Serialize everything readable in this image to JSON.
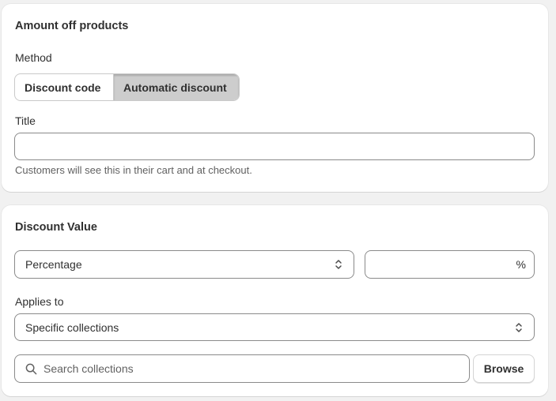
{
  "amount_card": {
    "title": "Amount off products",
    "method_label": "Method",
    "method_options": [
      "Discount code",
      "Automatic discount"
    ],
    "selected_method": "Automatic discount",
    "title_field_label": "Title",
    "title_value": "",
    "title_help": "Customers will see this in their cart and at checkout."
  },
  "value_card": {
    "title": "Discount Value",
    "value_type": "Percentage",
    "value_amount": "",
    "percent_suffix": "%",
    "applies_label": "Applies to",
    "applies_value": "Specific collections",
    "search_placeholder": "Search collections",
    "browse_label": "Browse"
  },
  "icons": {
    "select_chevron": "chevron-up-down-icon",
    "search": "search-icon"
  },
  "colors": {
    "selected_segment": "#cdcdcd",
    "card_background": "#ffffff",
    "page_background": "#f1f1f1"
  }
}
